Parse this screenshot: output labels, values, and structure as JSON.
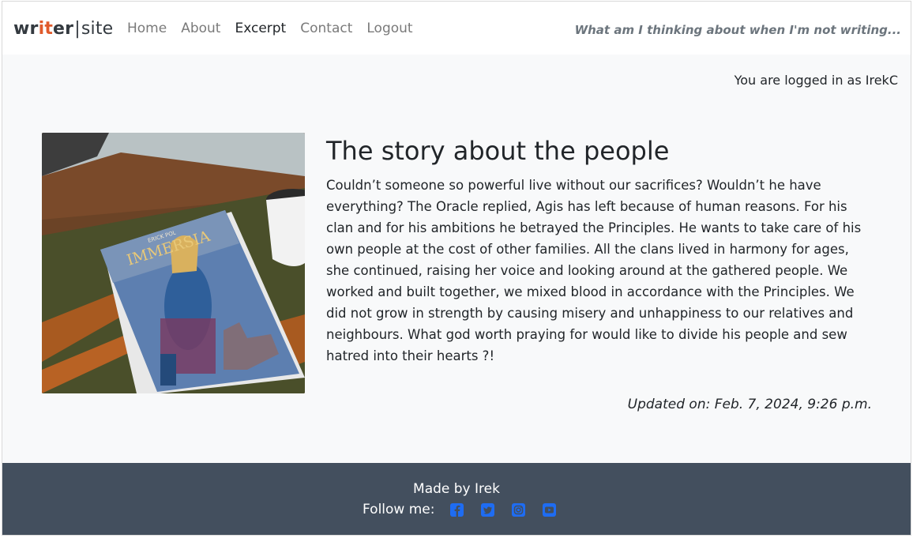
{
  "navbar": {
    "brand": {
      "part1": "wr",
      "part2": "it",
      "part3": "er",
      "separator": "|",
      "part4": "site"
    },
    "links": [
      {
        "label": "Home",
        "active": false
      },
      {
        "label": "About",
        "active": false
      },
      {
        "label": "Excerpt",
        "active": true
      },
      {
        "label": "Contact",
        "active": false
      },
      {
        "label": "Logout",
        "active": false
      }
    ],
    "tagline": "What am I thinking about when I'm not writing..."
  },
  "main": {
    "logged_in": "You are logged in as IrekC",
    "cover": {
      "author": "ERICK POL",
      "title": "IMMERSIA"
    },
    "post_title": "The story about the people",
    "post_body": "Couldn’t someone so powerful live without our sacrifices? Wouldn’t he have everything? The Oracle replied, Agis has left because of human reasons. For his clan and for his ambitions he betrayed the Principles. He wants to take care of his own people at the cost of other families. All the clans lived in harmony for ages, she continued, raising her voice and looking around at the gathered people. We worked and built together, we mixed blood in accordance with the Principles. We did not grow in strength by causing misery and unhappiness to our relatives and neighbours. What god worth praying for would like to divide his people and sew hatred into their hearts ?!",
    "updated": "Updated on: Feb. 7, 2024, 9:26 p.m."
  },
  "footer": {
    "made_by": "Made by Irek",
    "follow": "Follow me:",
    "social": [
      "facebook-icon",
      "twitter-icon",
      "instagram-icon",
      "youtube-icon"
    ]
  },
  "colors": {
    "accent": "#e05a2b",
    "footer_bg": "#434f5e",
    "social": "#1e6cf2",
    "page_bg": "#f8f9fa"
  }
}
